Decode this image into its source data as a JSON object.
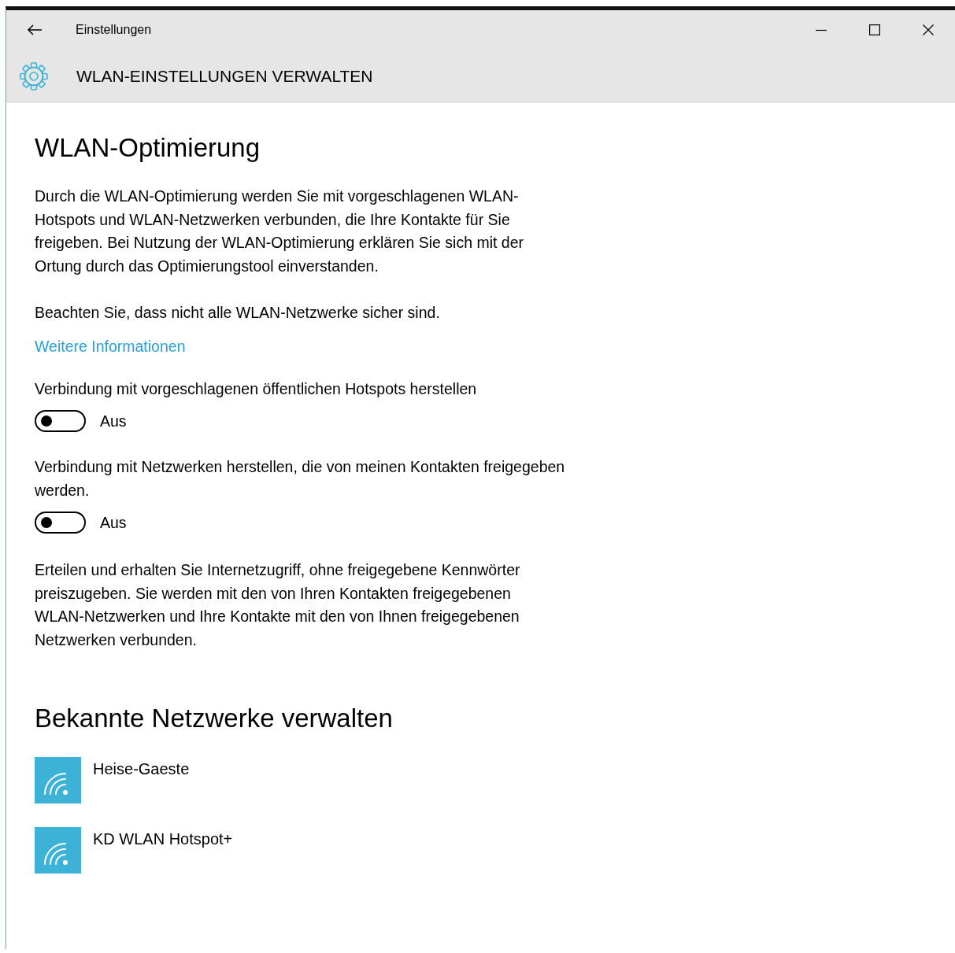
{
  "window": {
    "title": "Einstellungen"
  },
  "header": {
    "title": "WLAN-EINSTELLUNGEN VERWALTEN"
  },
  "sections": [
    {
      "heading": "WLAN-Optimierung",
      "blocks": [
        {
          "kind": "paragraph",
          "text": "Durch die WLAN-Optimierung werden Sie mit vorgeschlagenen WLAN-Hotspots und WLAN-Netzwerken verbunden, die Ihre Kontakte für Sie freigeben. Bei Nutzung der WLAN-Optimierung erklären Sie sich mit der Ortung durch das Optimierungstool einverstanden."
        },
        {
          "kind": "paragraph",
          "text": "Beachten Sie, dass nicht alle WLAN-Netzwerke sicher sind."
        },
        {
          "kind": "link",
          "text": "Weitere Informationen"
        },
        {
          "kind": "toggle",
          "label": "Verbindung mit vorgeschlagenen öffentlichen Hotspots herstellen",
          "on": false,
          "state_text": "Aus"
        },
        {
          "kind": "toggle",
          "label": "Verbindung mit Netzwerken herstellen, die von meinen Kontakten freigegeben werden.",
          "on": false,
          "state_text": "Aus"
        },
        {
          "kind": "paragraph",
          "text": "Erteilen und erhalten Sie Internetzugriff, ohne freigegebene Kennwörter preiszugeben. Sie werden mit den von Ihren Kontakten freigegebenen WLAN-Netzwerken und Ihre Kontakte mit den von Ihnen freigegebenen Netzwerken verbunden."
        }
      ]
    },
    {
      "heading": "Bekannte Netzwerke verwalten",
      "networks": [
        {
          "name": "Heise-Gaeste"
        },
        {
          "name": "KD WLAN Hotspot+"
        }
      ]
    }
  ]
}
